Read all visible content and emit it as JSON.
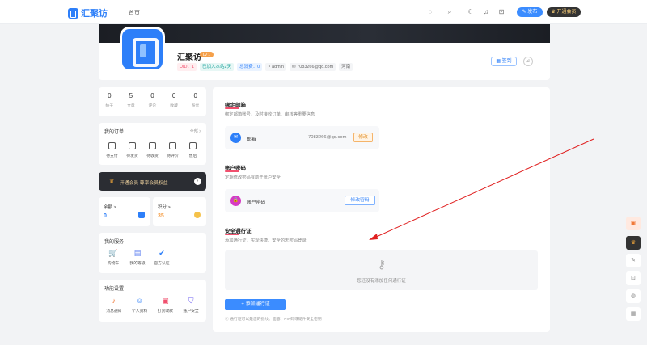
{
  "nav": {
    "brand": "汇聚访",
    "home": "首页",
    "publish": "发布",
    "vip": "开通会员"
  },
  "profile": {
    "name": "汇聚访",
    "level": "LV 1",
    "tags": [
      "UID：1",
      "已加入本站2天",
      "总消费：0",
      "admin",
      "7083266@qq.com",
      "河南"
    ],
    "sign": "签到"
  },
  "stats": [
    {
      "n": "0",
      "l": "帖子"
    },
    {
      "n": "5",
      "l": "文章"
    },
    {
      "n": "0",
      "l": "评论"
    },
    {
      "n": "0",
      "l": "收藏"
    },
    {
      "n": "0",
      "l": "粉丝"
    }
  ],
  "orders": {
    "title": "我的订单",
    "more": "全部 >",
    "items": [
      "待支付",
      "待发货",
      "待收货",
      "待评价",
      "售后"
    ]
  },
  "vip_bar": {
    "text": "开通会员 尊享会员权益"
  },
  "wallet": {
    "balance_label": "余额 >",
    "balance": "0",
    "points_label": "积分 >",
    "points": "35"
  },
  "services": {
    "title": "我的服务",
    "items": [
      "购物车",
      "我的等级",
      "官方认证"
    ]
  },
  "settings": {
    "title": "功能设置",
    "items": [
      "消息通知",
      "个人资料",
      "打赏收款",
      "账户安全"
    ]
  },
  "main": {
    "email_section": {
      "title": "绑定邮箱",
      "desc": "绑定邮箱账号，及时接收订单、审核等重要信息",
      "label": "邮箱",
      "value": "7083266@qq.com",
      "button": "修改"
    },
    "pwd_section": {
      "title": "账户密码",
      "desc": "定期修改密码有助于账户安全",
      "label": "账户密码",
      "button": "修改密码"
    },
    "pass_section": {
      "title": "安全通行证",
      "desc": "添加通行证，实现快捷、安全的无密码登录",
      "empty": "您还没有添加任何通行证",
      "add": "+ 添加通行证",
      "hint": "通行证可以是您的指纹、面容、PIN码或硬件安全密钥"
    }
  },
  "colors": {
    "primary": "#3b8cff",
    "accent": "#f0506e",
    "dark": "#2b2d33"
  }
}
